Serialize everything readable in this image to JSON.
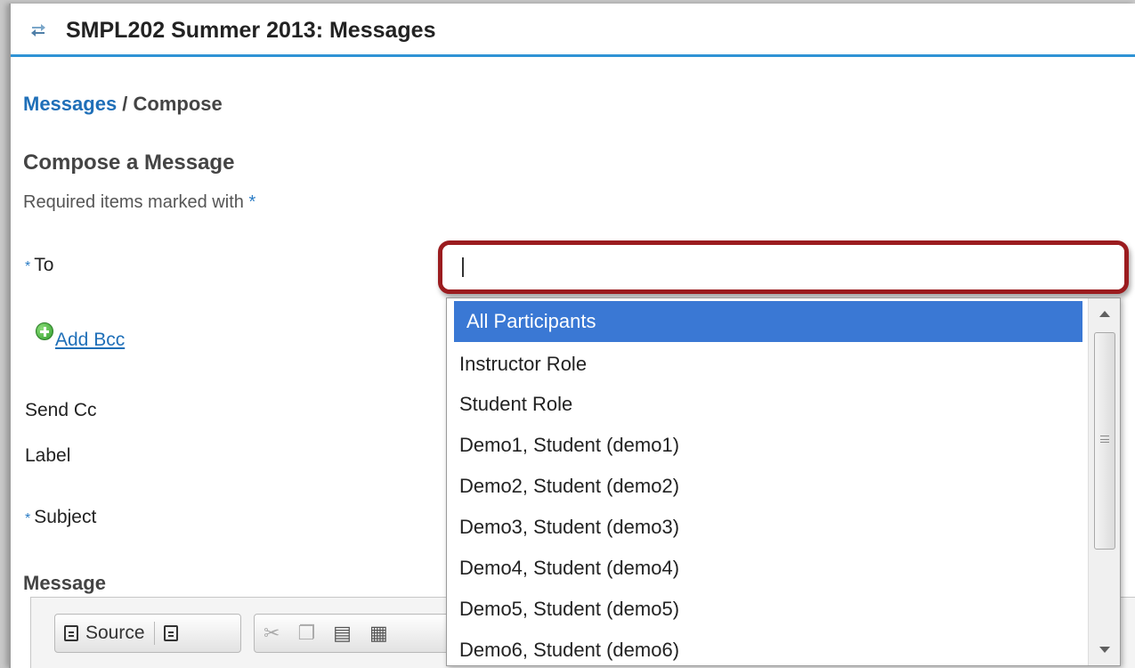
{
  "header": {
    "title": "SMPL202 Summer 2013: Messages"
  },
  "breadcrumb": {
    "link": "Messages",
    "separator": " / ",
    "current": "Compose"
  },
  "page": {
    "section_title": "Compose a Message",
    "required_note": "Required items marked with ",
    "required_star": "*"
  },
  "form": {
    "to_label": "To",
    "to_value": "",
    "add_bcc": "Add Bcc",
    "send_cc_label": "Send Cc",
    "label_label": "Label",
    "subject_label": "Subject",
    "message_label": "Message"
  },
  "dropdown": {
    "options": [
      "All Participants",
      "Instructor Role",
      "Student Role",
      "Demo1, Student (demo1)",
      "Demo2, Student (demo2)",
      "Demo3, Student (demo3)",
      "Demo4, Student (demo4)",
      "Demo5, Student (demo5)",
      "Demo6, Student (demo6)"
    ],
    "selected_index": 0
  },
  "toolbar": {
    "source_label": "Source"
  },
  "icons": {
    "title": "sync-arrows-icon",
    "add_bcc": "plus-circle-icon",
    "source": "source-icon",
    "template": "document-icon",
    "cut": "scissors-icon",
    "copy": "copy-icon",
    "paste": "paste-icon",
    "paste_text": "paste-text-icon"
  },
  "colors": {
    "accent_blue": "#2f93d5",
    "link_blue": "#1f6fb8",
    "highlight_border": "#9b1c1f",
    "selected_option": "#3a78d4"
  }
}
